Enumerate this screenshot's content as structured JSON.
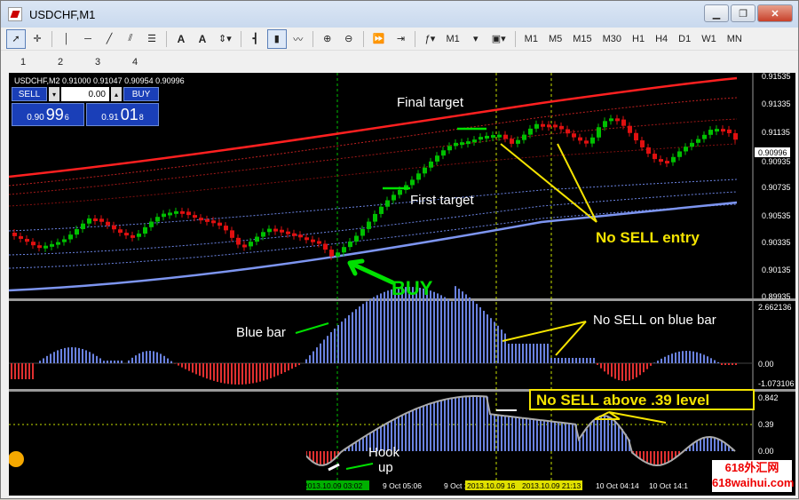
{
  "window": {
    "title": "USDCHF,M1"
  },
  "toolbar": {
    "font_a1": "A",
    "font_a2": "A",
    "tf_m1_dropdown": "M1",
    "timeframes": [
      "M1",
      "M5",
      "M15",
      "M30",
      "H1",
      "H4",
      "D1",
      "W1",
      "MN"
    ]
  },
  "numbar": [
    "1",
    "2",
    "3",
    "4"
  ],
  "chart": {
    "header": "USDCHF,M2  0.91000 0.91047 0.90954 0.90996",
    "price_ticks": [
      "0.91535",
      "0.91335",
      "0.91135",
      "0.90935",
      "0.90735",
      "0.90535",
      "0.90335",
      "0.90135",
      "0.89935"
    ],
    "current_price": "0.90996",
    "ind1_ticks": [
      "2.662136",
      "0.00",
      "-1.073106"
    ],
    "ind2_ticks": [
      "0.842",
      "0.39",
      "0.00"
    ],
    "time_labels": {
      "t1": "2013.10.09 03:02",
      "t2": "9 Oct 05:06",
      "t3": "9 Oct 1",
      "t4": "2013.10.09 16",
      "t5": "2013.10.09 21:13",
      "t6": "10 Oct 04:14",
      "t7": "10 Oct 14:1"
    }
  },
  "trade_panel": {
    "sell_label": "SELL",
    "lot": "0.00",
    "buy_label": "BUY",
    "bid_small": "0.90",
    "bid_big": "99",
    "bid_sup": "6",
    "ask_small": "0.91",
    "ask_big": "01",
    "ask_sup": "8"
  },
  "annotations": {
    "final_target": "Final target",
    "first_target": "First target",
    "no_sell_entry": "No SELL entry",
    "buy": "BUY",
    "blue_bar": "Blue bar",
    "no_sell_blue": "No SELL on blue bar",
    "no_sell_above": "No SELL above .39 level",
    "hook_line1": "Hook",
    "hook_line2": "up"
  },
  "watermark": {
    "line1": "618外汇网",
    "line2": "618waihui.com"
  },
  "colors": {
    "bull": "#00c000",
    "bear": "#e01010",
    "hist_pos": "#6a82e0",
    "hist_neg": "#e03030",
    "annot": "#f5e400"
  }
}
